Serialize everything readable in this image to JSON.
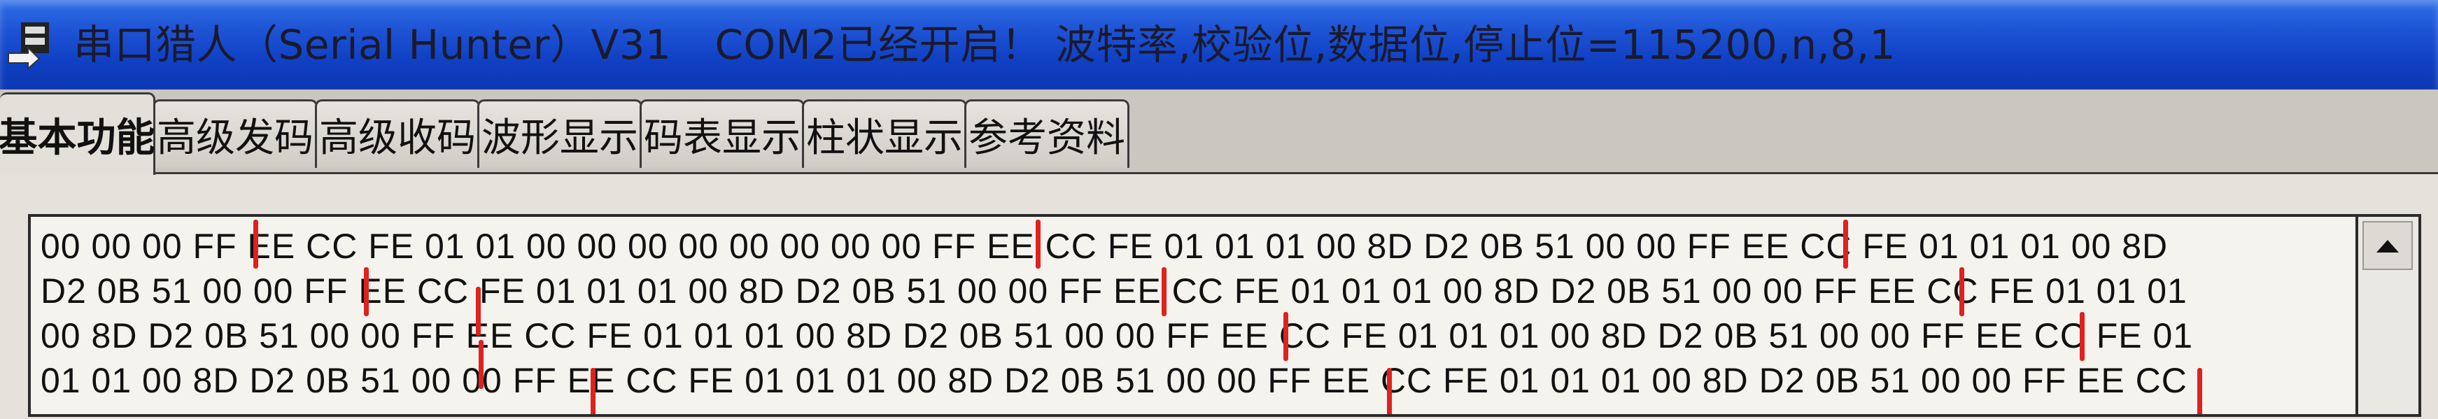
{
  "window": {
    "title": "串口猎人（Serial Hunter）V31",
    "status": "COM2已经开启！ 波特率,校验位,数据位,停止位=115200,n,8,1"
  },
  "tabs": [
    {
      "label": "基本功能",
      "active": true
    },
    {
      "label": "高级发码",
      "active": false
    },
    {
      "label": "高级收码",
      "active": false
    },
    {
      "label": "波形显示",
      "active": false
    },
    {
      "label": "码表显示",
      "active": false
    },
    {
      "label": "柱状显示",
      "active": false
    },
    {
      "label": "参考资料",
      "active": false
    }
  ],
  "receive": {
    "lines": [
      "00 00 00 FF EE CC FE 01 01 00 00 00 00 00 00 00 00 FF EE CC FE 01 01 01 00 8D D2 0B 51 00 00 FF EE CC FE 01 01 01 00 8D",
      "D2 0B 51 00 00 FF EE CC FE 01 01 01 00 8D D2 0B 51 00 00 FF EE CC FE 01 01 01 00 8D D2 0B 51 00 00 FF EE CC FE 01 01 01",
      "00 8D D2 0B 51 00 00 FF EE CC FE 01 01 01 00 8D D2 0B 51 00 00 FF EE CC FE 01 01 01 00 8D D2 0B 51 00 00 FF EE CC FE 01",
      "01 01 00 8D D2 0B 51 00 00 FF EE CC FE 01 01 01 00 8D D2 0B 51 00 00 FF EE CC FE 01 01 01 00 8D D2 0B 51 00 00 FF EE CC"
    ]
  },
  "colors": {
    "marker": "#e0211f",
    "titlebar": "#1d52d4"
  },
  "icons": {
    "app": "serial-port-icon",
    "scroll_up": "arrow-up-icon"
  }
}
